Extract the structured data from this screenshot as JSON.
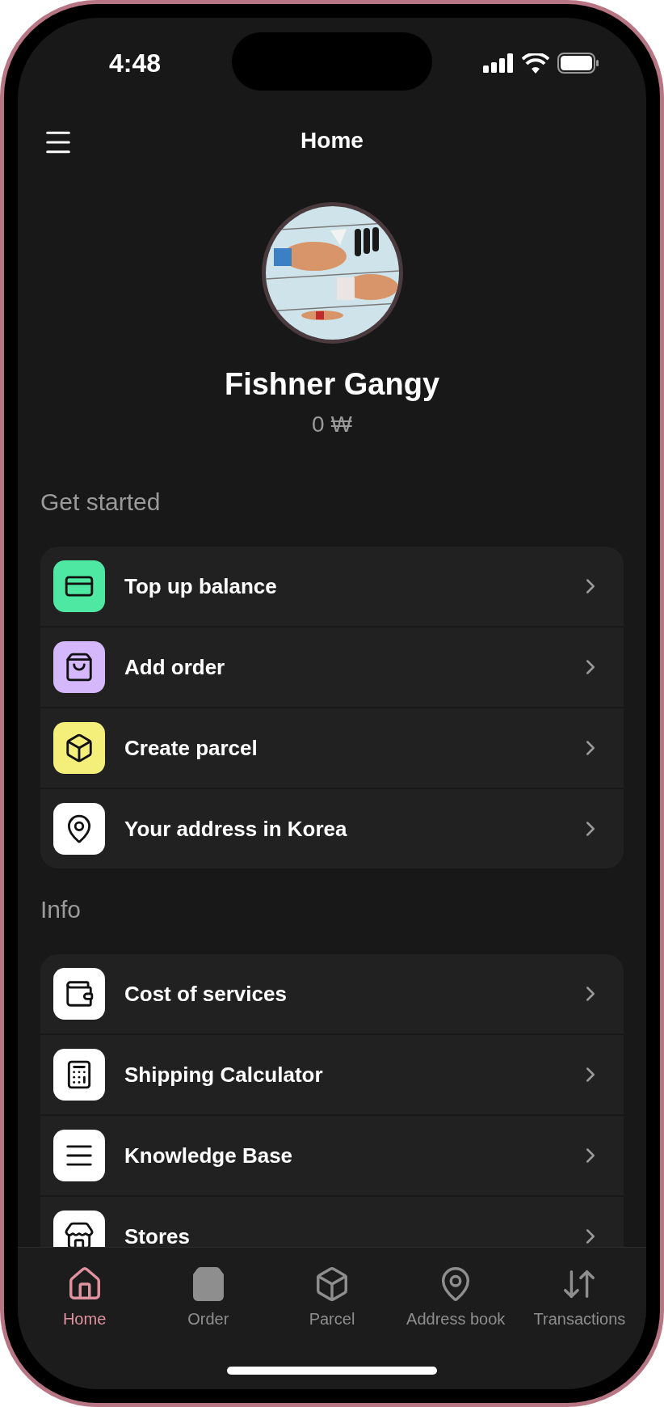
{
  "status_bar": {
    "time": "4:48"
  },
  "header": {
    "title": "Home"
  },
  "profile": {
    "name": "Fishner Gangy",
    "balance": "0 ₩"
  },
  "sections": [
    {
      "title": "Get started",
      "items": [
        {
          "label": "Top up balance",
          "kind": "card",
          "color": "#4ee8a3"
        },
        {
          "label": "Add order",
          "kind": "bag",
          "color": "#d4b8fb"
        },
        {
          "label": "Create parcel",
          "kind": "box",
          "color": "#f4ef7a"
        },
        {
          "label": "Your address in Korea",
          "kind": "pin",
          "color": "#ffffff"
        }
      ]
    },
    {
      "title": "Info",
      "items": [
        {
          "label": "Cost of services",
          "kind": "wallet",
          "color": "#ffffff"
        },
        {
          "label": "Shipping Calculator",
          "kind": "calculator",
          "color": "#ffffff"
        },
        {
          "label": "Knowledge Base",
          "kind": "stack",
          "color": "#ffffff"
        },
        {
          "label": "Stores",
          "kind": "store",
          "color": "#ffffff"
        }
      ]
    }
  ],
  "tab_bar": [
    {
      "label": "Home",
      "kind": "house",
      "selected": true
    },
    {
      "label": "Order",
      "kind": "bag",
      "selected": false
    },
    {
      "label": "Parcel",
      "kind": "box",
      "selected": false
    },
    {
      "label": "Address book",
      "kind": "pin",
      "selected": false
    },
    {
      "label": "Transactions",
      "kind": "arrows",
      "selected": false
    }
  ]
}
